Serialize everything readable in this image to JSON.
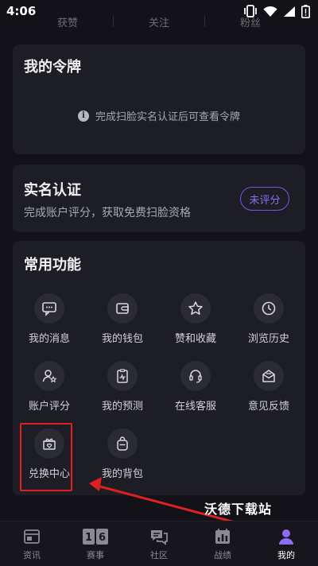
{
  "status_bar": {
    "time": "4:06"
  },
  "stats": {
    "likes": "获赞",
    "following": "关注",
    "fans": "粉丝"
  },
  "token_card": {
    "title": "我的令牌",
    "notice": "完成扫脸实名认证后可查看令牌"
  },
  "auth_card": {
    "title": "实名认证",
    "subtitle": "完成账户评分，获取免费扫脸资格",
    "badge": "未评分"
  },
  "functions": {
    "title": "常用功能",
    "items": [
      {
        "label": "我的消息",
        "icon": "message-icon"
      },
      {
        "label": "我的钱包",
        "icon": "wallet-icon"
      },
      {
        "label": "赞和收藏",
        "icon": "star-icon"
      },
      {
        "label": "浏览历史",
        "icon": "clock-icon"
      },
      {
        "label": "账户评分",
        "icon": "user-star-icon"
      },
      {
        "label": "我的预测",
        "icon": "chart-clipboard-icon"
      },
      {
        "label": "在线客服",
        "icon": "headset-icon"
      },
      {
        "label": "意见反馈",
        "icon": "feedback-mail-icon"
      },
      {
        "label": "兑换中心",
        "icon": "gift-icon"
      },
      {
        "label": "我的背包",
        "icon": "backpack-icon"
      }
    ]
  },
  "watermark": "沃德下载站",
  "tabs": [
    {
      "label": "资讯",
      "icon": "news-icon",
      "active": false
    },
    {
      "label": "赛事",
      "icon": "match-icon",
      "active": false
    },
    {
      "label": "社区",
      "icon": "community-icon",
      "active": false
    },
    {
      "label": "战绩",
      "icon": "record-icon",
      "active": false
    },
    {
      "label": "我的",
      "icon": "profile-icon",
      "active": true
    }
  ],
  "colors": {
    "background": "#121218",
    "card": "#1d1d26",
    "accent": "#7a55e8",
    "active_tab": "#8f6cf5",
    "annotation": "#e02020"
  }
}
